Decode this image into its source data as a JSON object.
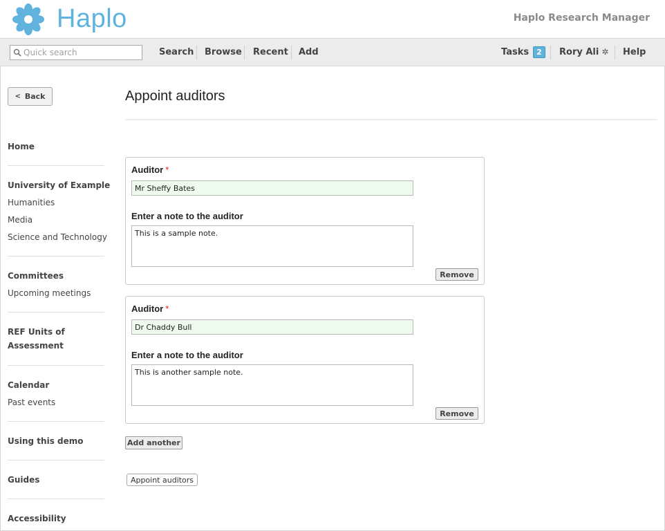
{
  "header": {
    "logo_text": "Haplo",
    "app_name": "Haplo Research Manager",
    "brand_color": "#5fb3dc"
  },
  "navbar": {
    "search_placeholder": "Quick search",
    "search_icon": "search-icon",
    "items": [
      {
        "label": "Search"
      },
      {
        "label": "Browse"
      },
      {
        "label": "Recent"
      },
      {
        "label": "Add"
      }
    ],
    "tasks_label": "Tasks",
    "tasks_count": "2",
    "user_name": "Rory Ali",
    "user_icon": "gear-icon",
    "help_label": "Help"
  },
  "sidebar": {
    "back_label": "Back",
    "home": "Home",
    "university": "University of Example",
    "university_items": [
      "Humanities",
      "Media",
      "Science and Technology"
    ],
    "committees": "Committees",
    "committees_items": [
      "Upcoming meetings"
    ],
    "ref_line1": "REF Units of",
    "ref_line2": "Assessment",
    "calendar": "Calendar",
    "calendar_items": [
      "Past events"
    ],
    "using_demo": "Using this demo",
    "guides": "Guides",
    "accessibility": "Accessibility"
  },
  "main": {
    "title": "Appoint auditors",
    "auditor_label": "Auditor",
    "required_mark": "*",
    "note_label": "Enter a note to the auditor",
    "remove_label": "Remove",
    "auditors": [
      {
        "name": "Mr Sheffy Bates",
        "note": "This is a sample note."
      },
      {
        "name": "Dr Chaddy Bull",
        "note": "This is another sample note."
      }
    ],
    "add_another_label": "Add another",
    "submit_label": "Appoint auditors"
  }
}
